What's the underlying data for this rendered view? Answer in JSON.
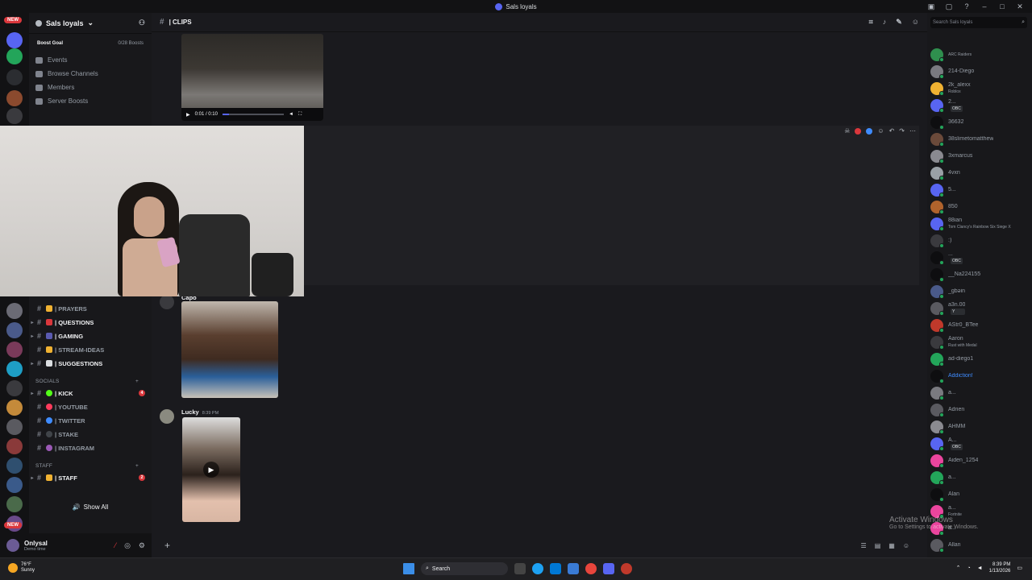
{
  "window": {
    "title": "Sals loyals"
  },
  "server_rail": {
    "new_label": "NEW"
  },
  "sidebar": {
    "guild_name": "Sals loyals",
    "boost_goal": "Boost Goal",
    "boost_count": "0/28 Boosts",
    "nav": [
      {
        "label": "Events"
      },
      {
        "label": "Browse Channels"
      },
      {
        "label": "Members"
      },
      {
        "label": "Server Boosts"
      }
    ],
    "channels_top": [
      {
        "label": "| PRAYERS",
        "unread": false
      },
      {
        "label": "| QUESTIONS",
        "unread": true
      },
      {
        "label": "| GAMING",
        "unread": true
      },
      {
        "label": "| STREAM-IDEAS",
        "unread": false
      },
      {
        "label": "| SUGGESTIONS",
        "unread": true
      }
    ],
    "socials_label": "SOCIALS",
    "socials": [
      {
        "label": "| KICK",
        "badge": "4",
        "color": "#53fc18"
      },
      {
        "label": "| YOUTUBE",
        "badge": "",
        "color": "#ff3b5c"
      },
      {
        "label": "| TWITTER",
        "badge": "",
        "color": "#3f8cff"
      },
      {
        "label": "| STAKE",
        "badge": "",
        "color": "#404449"
      },
      {
        "label": "| INSTAGRAM",
        "badge": "",
        "color": "#9b59b6"
      }
    ],
    "staff_label": "STAFF",
    "staff": [
      {
        "label": "| STAFF",
        "badge": "2"
      }
    ],
    "show_all": "Show All"
  },
  "user_panel": {
    "name": "Onlysal",
    "status": "Demo time"
  },
  "channel": {
    "name": "| CLIPS"
  },
  "video": {
    "time": "0:01 / 0:10",
    "progress": 0.1
  },
  "messages": [
    {
      "author": "Capo",
      "timestamp": ""
    },
    {
      "author": "Lucky",
      "timestamp": "8:39 PM"
    }
  ],
  "members": {
    "search_placeholder": "Search Sals loyals",
    "list": [
      {
        "name": "",
        "sub": "ARC Raiders",
        "color": "#2f8f4e",
        "blue": false,
        "tag": ""
      },
      {
        "name": "214-Diego",
        "sub": "",
        "color": "#7a7a80",
        "blue": false,
        "tag": ""
      },
      {
        "name": "2k_alexx",
        "sub": "Roblox",
        "color": "#f0b232",
        "blue": false,
        "tag": ""
      },
      {
        "name": "2...",
        "sub": "",
        "color": "#5865f2",
        "blue": false,
        "tag": "OBC"
      },
      {
        "name": "36632",
        "sub": "",
        "color": "#0e0e10",
        "blue": false,
        "tag": ""
      },
      {
        "name": "38slimetomatthew",
        "sub": "",
        "color": "#6b4a3a",
        "blue": false,
        "tag": ""
      },
      {
        "name": "3xmarcus",
        "sub": "",
        "color": "#8a8a90",
        "blue": false,
        "tag": ""
      },
      {
        "name": "4vxn",
        "sub": "",
        "color": "#9aa0a6",
        "blue": false,
        "tag": ""
      },
      {
        "name": "5...",
        "sub": "",
        "color": "#5865f2",
        "blue": false,
        "tag": ""
      },
      {
        "name": "850",
        "sub": "",
        "color": "#b0632c",
        "blue": false,
        "tag": ""
      },
      {
        "name": "88ian",
        "sub": "Tom Clancy's Rainbow Six Siege X",
        "color": "#5865f2",
        "blue": false,
        "tag": ""
      },
      {
        "name": ":)",
        "sub": "",
        "color": "#3a3a3e",
        "blue": false,
        "tag": ""
      },
      {
        "name": "...",
        "sub": "",
        "color": "#0e0e10",
        "blue": false,
        "tag": "OBC"
      },
      {
        "name": "__Na224155",
        "sub": "",
        "color": "#0e0e10",
        "blue": false,
        "tag": ""
      },
      {
        "name": "_gbәin",
        "sub": "",
        "color": "#4a5a8a",
        "blue": false,
        "tag": ""
      },
      {
        "name": "a3n.00",
        "sub": "",
        "color": "#5a5a60",
        "blue": false,
        "tag": "Y"
      },
      {
        "name": "AStr0_BTee",
        "sub": "",
        "color": "#c0392b",
        "blue": false,
        "tag": ""
      },
      {
        "name": "Aaron",
        "sub": "Rust with Medal",
        "color": "#3a3a3e",
        "blue": false,
        "tag": ""
      },
      {
        "name": "ad-diego1",
        "sub": "",
        "color": "#23a55a",
        "blue": false,
        "tag": ""
      },
      {
        "name": "Addiction!",
        "sub": "",
        "color": "#0e0e10",
        "blue": true,
        "tag": ""
      },
      {
        "name": "a...",
        "sub": "",
        "color": "#7a7a80",
        "blue": false,
        "tag": ""
      },
      {
        "name": "Adrien",
        "sub": "",
        "color": "#5a5a60",
        "blue": false,
        "tag": ""
      },
      {
        "name": "AHMM",
        "sub": "",
        "color": "#8a8a90",
        "blue": false,
        "tag": ""
      },
      {
        "name": "A...",
        "sub": "",
        "color": "#5865f2",
        "blue": false,
        "tag": "OBC"
      },
      {
        "name": "Aiden_1254",
        "sub": "",
        "color": "#eb459e",
        "blue": false,
        "tag": ""
      },
      {
        "name": "a...",
        "sub": "",
        "color": "#23a55a",
        "blue": false,
        "tag": ""
      },
      {
        "name": "Alan",
        "sub": "",
        "color": "#0e0e10",
        "blue": false,
        "tag": ""
      },
      {
        "name": "a...",
        "sub": "Fortnite",
        "color": "#eb459e",
        "blue": false,
        "tag": ""
      },
      {
        "name": "a...",
        "sub": "",
        "color": "#eb459e",
        "blue": false,
        "tag": ""
      },
      {
        "name": "Allan",
        "sub": "",
        "color": "#5a5a60",
        "blue": false,
        "tag": ""
      }
    ]
  },
  "watermark": {
    "title": "Activate Windows",
    "subtitle": "Go to Settings to activate Windows."
  },
  "taskbar": {
    "weather_temp": "76°F",
    "weather_desc": "Sunny",
    "search_placeholder": "Search",
    "time": "8:39 PM",
    "date": "1/13/2026"
  },
  "colors": {
    "accent": "#5865f2",
    "danger": "#da373c",
    "online": "#23a55a"
  }
}
